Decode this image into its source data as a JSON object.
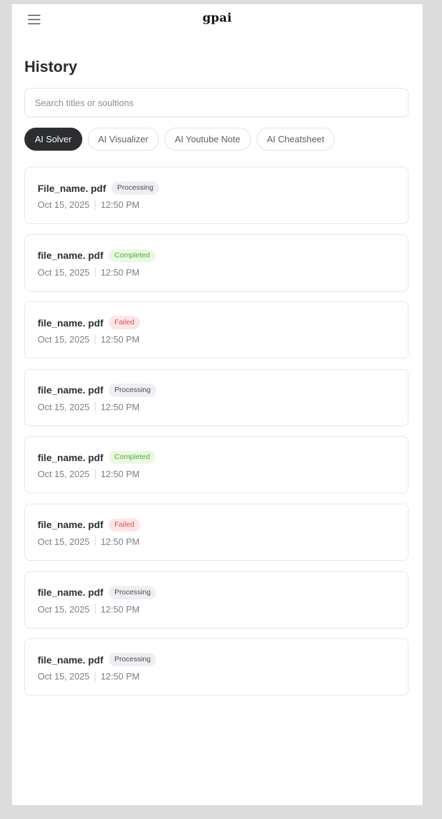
{
  "header": {
    "brand": "gpai",
    "menu_icon": "hamburger-menu-icon"
  },
  "page": {
    "title": "History"
  },
  "search": {
    "placeholder": "Search titles or soultions",
    "value": ""
  },
  "tabs": [
    {
      "label": "AI Solver",
      "active": true
    },
    {
      "label": "AI Visualizer",
      "active": false
    },
    {
      "label": "AI Youtube Note",
      "active": false
    },
    {
      "label": "AI Cheatsheet",
      "active": false
    }
  ],
  "status_colors": {
    "Processing": "#4a4d55",
    "Completed": "#4cb02a",
    "Failed": "#e0474f"
  },
  "items": [
    {
      "name": "File_name. pdf",
      "status": "Processing",
      "date": "Oct 15, 2025",
      "time": "12:50 PM"
    },
    {
      "name": "file_name. pdf",
      "status": "Completed",
      "date": "Oct 15, 2025",
      "time": "12:50 PM"
    },
    {
      "name": "file_name. pdf",
      "status": "Failed",
      "date": "Oct 15, 2025",
      "time": "12:50 PM"
    },
    {
      "name": "file_name. pdf",
      "status": "Processing",
      "date": "Oct 15, 2025",
      "time": "12:50 PM"
    },
    {
      "name": "file_name. pdf",
      "status": "Completed",
      "date": "Oct 15, 2025",
      "time": "12:50 PM"
    },
    {
      "name": "file_name. pdf",
      "status": "Failed",
      "date": "Oct 15, 2025",
      "time": "12:50 PM"
    },
    {
      "name": "file_name. pdf",
      "status": "Processing",
      "date": "Oct 15, 2025",
      "time": "12:50 PM"
    },
    {
      "name": "file_name. pdf",
      "status": "Processing",
      "date": "Oct 15, 2025",
      "time": "12:50 PM"
    }
  ]
}
